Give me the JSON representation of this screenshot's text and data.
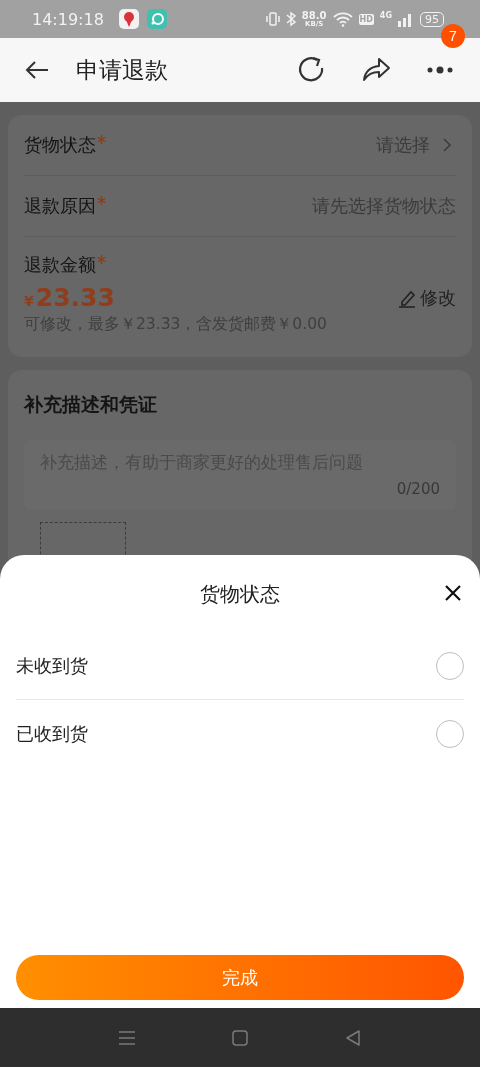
{
  "status_bar": {
    "time": "14:19:18",
    "net_speed": "88.0",
    "net_unit": "KB/S",
    "hd": "HD",
    "network": "4G",
    "battery": "95"
  },
  "header": {
    "title": "申请退款",
    "badge": "7"
  },
  "form": {
    "rows": [
      {
        "label": "货物状态",
        "required": true,
        "value": "请选择",
        "chevron": true
      },
      {
        "label": "退款原因",
        "required": true,
        "value": "请先选择货物状态",
        "chevron": false
      }
    ],
    "amount": {
      "label": "退款金额",
      "required": true,
      "currency": "¥",
      "value": "23.33",
      "edit": "修改",
      "note": "可修改，最多￥23.33，含发货邮费￥0.00"
    }
  },
  "evidence": {
    "title": "补充描述和凭证",
    "placeholder": "补充描述，有助于商家更好的处理售后问题",
    "counter": "0/200"
  },
  "sheet": {
    "title": "货物状态",
    "options": [
      {
        "label": "未收到货",
        "selected": false
      },
      {
        "label": "已收到货",
        "selected": false
      }
    ],
    "button": "完成"
  }
}
